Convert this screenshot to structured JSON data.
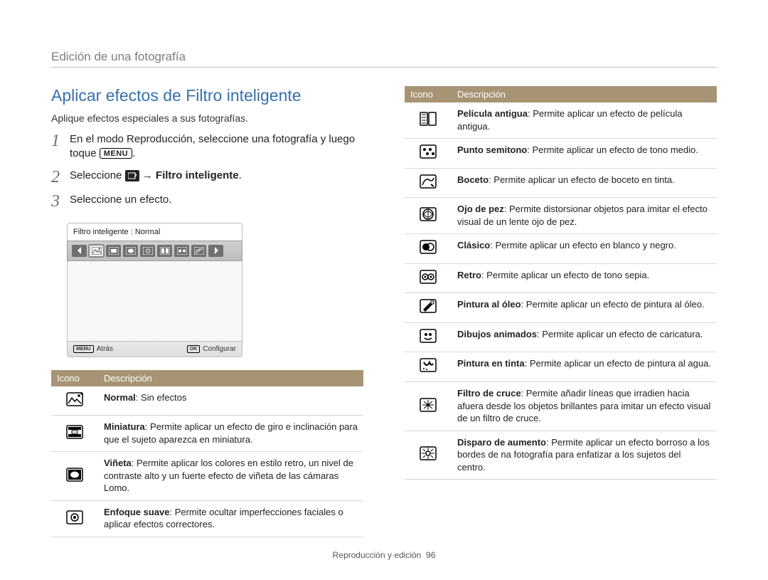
{
  "header": {
    "section": "Edición de una fotografía"
  },
  "title": "Aplicar efectos de Filtro inteligente",
  "lead": "Aplique efectos especiales a sus fotografías.",
  "steps": {
    "s1": {
      "n": "1",
      "pre": "En el modo Reproducción, seleccione una fotografía y luego toque ",
      "menu": "MENU",
      "post": "."
    },
    "s2": {
      "n": "2",
      "pre": "Seleccione ",
      "arrow": "→ ",
      "bold": "Filtro inteligente",
      "post": "."
    },
    "s3": {
      "n": "3",
      "text": "Seleccione un efecto."
    }
  },
  "device": {
    "title": "Filtro inteligente : Normal",
    "back": "Atrás",
    "back_btn": "MENU",
    "ok": "Configurar",
    "ok_btn": "OK"
  },
  "table_headers": {
    "icon": "Icono",
    "desc": "Descripción"
  },
  "left_rows": [
    {
      "term": "Normal",
      "text": ": Sin efectos"
    },
    {
      "term": "Miniatura",
      "text": ": Permite aplicar un efecto de giro e inclinación para que el sujeto aparezca en miniatura."
    },
    {
      "term": "Viñeta",
      "text": ": Permite aplicar los colores en estilo retro, un nivel de contraste alto y un fuerte efecto de viñeta de las cámaras Lomo."
    },
    {
      "term": "Enfoque suave",
      "text": ": Permite ocultar imperfecciones faciales o aplicar efectos correctores."
    }
  ],
  "right_rows": [
    {
      "term": "Película antigua",
      "text": ": Permite aplicar un efecto de película antigua."
    },
    {
      "term": "Punto semitono",
      "text": ": Permite aplicar un efecto de tono medio."
    },
    {
      "term": "Boceto",
      "text": ": Permite aplicar un efecto de boceto en tinta."
    },
    {
      "term": "Ojo de pez",
      "text": ": Permite distorsionar objetos para imitar el efecto visual de un lente ojo de pez."
    },
    {
      "term": "Clásico",
      "text": ": Permite aplicar un efecto en blanco y negro."
    },
    {
      "term": "Retro",
      "text": ": Permite aplicar un efecto de tono sepia."
    },
    {
      "term": "Pintura al óleo",
      "text": ": Permite aplicar un efecto de pintura al óleo."
    },
    {
      "term": "Dibujos animados",
      "text": ": Permite aplicar un efecto de caricatura."
    },
    {
      "term": "Pintura en tinta",
      "text": ": Permite aplicar un efecto de pintura al agua."
    },
    {
      "term": "Filtro de cruce",
      "text": ": Permite añadir líneas que irradien hacia afuera desde los objetos brillantes para imitar un efecto visual de un filtro de cruce."
    },
    {
      "term": "Disparo de aumento",
      "text": ": Permite aplicar un efecto borroso a los bordes de na fotografía para enfatizar a los sujetos del centro."
    }
  ],
  "footer": {
    "label": "Reproducción y edición",
    "page": "96"
  }
}
